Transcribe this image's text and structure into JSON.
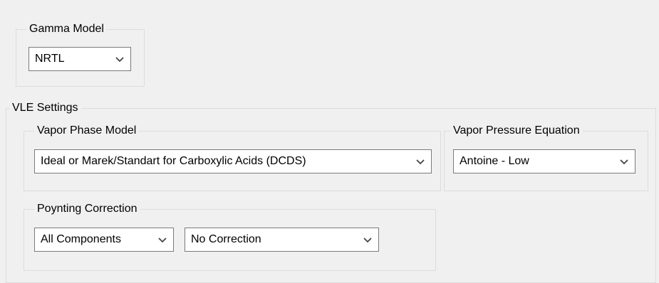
{
  "gamma_model": {
    "legend": "Gamma Model",
    "selected": "NRTL",
    "dropdown_icon": "chevron-down-icon"
  },
  "vle_settings": {
    "legend": "VLE Settings",
    "vapor_phase_model": {
      "legend": "Vapor Phase Model",
      "selected": "Ideal or Marek/Standart for Carboxylic Acids (DCDS)"
    },
    "vapor_pressure_equation": {
      "legend": "Vapor Pressure Equation",
      "selected": "Antoine - Low"
    },
    "poynting_correction": {
      "legend": "Poynting Correction",
      "components_selected": "All Components",
      "correction_selected": "No Correction"
    }
  },
  "colors": {
    "background": "#f0f0f0",
    "group_border": "#dcdcdc",
    "combo_border": "#7a7a7a",
    "combo_background": "#ffffff"
  }
}
